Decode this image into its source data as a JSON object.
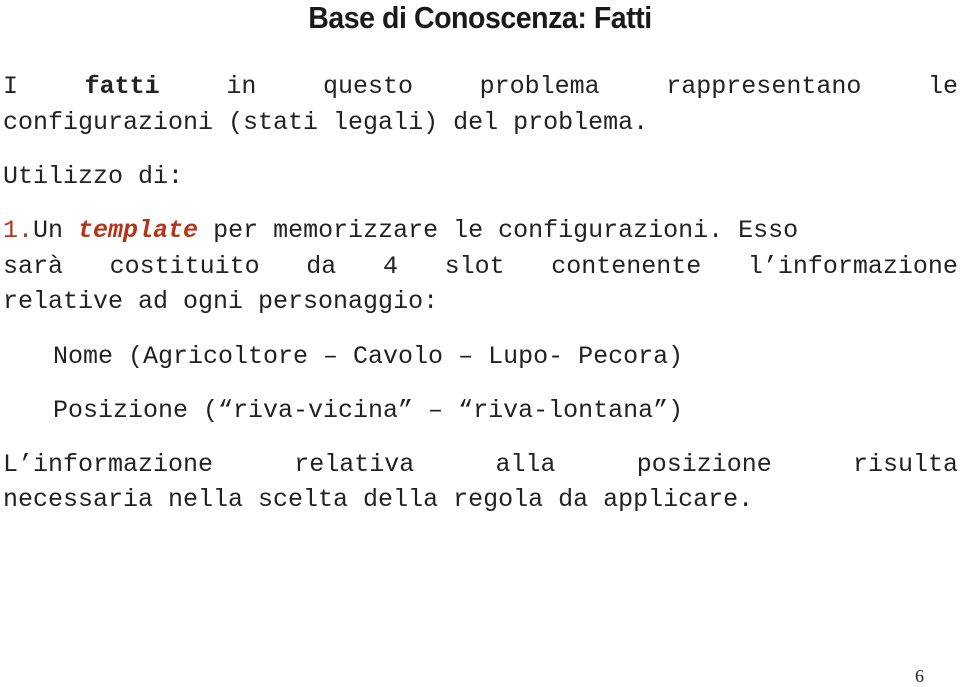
{
  "title": "Base di Conoscenza: Fatti",
  "intro": {
    "line1_words": [
      "I",
      "fatti",
      "in",
      "questo",
      "problema",
      "rappresentano",
      "le"
    ],
    "line2": "configurazioni (stati legali) del problema."
  },
  "usage_label": "Utilizzo di:",
  "item1": {
    "number": "1.",
    "pre": "Un ",
    "keyword": "template",
    "post": " per memorizzare le configurazioni. Esso",
    "line2_words": [
      "sarà",
      "costituito",
      "da",
      "4",
      "slot",
      "contenente",
      "l’informazione"
    ],
    "line3": "relative ad ogni personaggio:"
  },
  "slots": [
    "Nome (Agricoltore – Cavolo – Lupo- Pecora)",
    "Posizione (“riva-vicina” – “riva-lontana”)"
  ],
  "conclusion": {
    "line1_words": [
      "L’informazione",
      "relativa",
      "alla",
      "posizione",
      "risulta"
    ],
    "line2": "necessaria nella scelta della regola da applicare."
  },
  "page_number": "6"
}
